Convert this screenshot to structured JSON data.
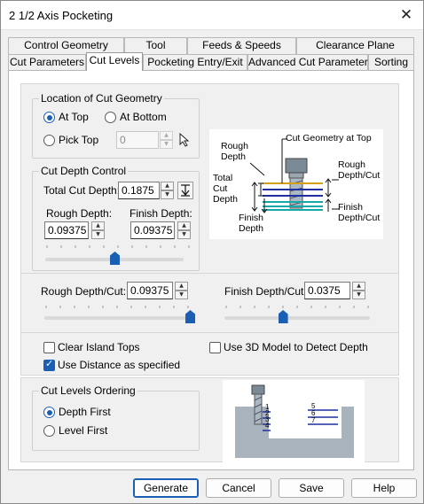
{
  "window": {
    "title": "2 1/2 Axis Pocketing",
    "close_glyph": "✕"
  },
  "tabs_back": [
    "Control Geometry",
    "Tool",
    "Feeds & Speeds",
    "Clearance Plane"
  ],
  "tabs_front": [
    "Cut Parameters",
    "Cut Levels",
    "Pocketing Entry/Exit",
    "Advanced Cut Parameters",
    "Sorting"
  ],
  "active_tab": "Cut Levels",
  "location": {
    "group_label": "Location of Cut Geometry",
    "at_top": "At Top",
    "at_bottom": "At Bottom",
    "pick_top": "Pick Top",
    "pick_top_value": "0",
    "selected": "At Top"
  },
  "depth_control": {
    "group_label": "Cut Depth Control",
    "total_label": "Total Cut Depth:",
    "total_value": "0.1875",
    "rough_label": "Rough Depth:",
    "rough_value": "0.09375",
    "finish_label": "Finish Depth:",
    "finish_value": "0.09375",
    "split_fraction": 0.5
  },
  "per_cut": {
    "rough_label": "Rough Depth/Cut:",
    "rough_value": "0.09375",
    "rough_fraction": 1.0,
    "finish_label": "Finish Depth/Cut:",
    "finish_value": "0.0375",
    "finish_fraction": 0.4
  },
  "options": {
    "clear_island": "Clear Island Tops",
    "clear_island_checked": false,
    "use_3d": "Use 3D Model to Detect Depth",
    "use_3d_checked": false,
    "use_distance": "Use Distance as specified",
    "use_distance_checked": true
  },
  "ordering": {
    "group_label": "Cut Levels Ordering",
    "depth_first": "Depth First",
    "level_first": "Level First",
    "selected": "Depth First"
  },
  "diagram1": {
    "rough_depth": "Rough Depth",
    "cut_geom": "Cut Geometry at Top",
    "total_cut_depth": "Total Cut Depth",
    "finish_depth": "Finish Depth",
    "rough_per_cut": "Rough Depth/Cut",
    "finish_per_cut": "Finish Depth/Cut"
  },
  "diagram2": {
    "labels": [
      "1",
      "2",
      "3",
      "4",
      "5",
      "6",
      "7"
    ]
  },
  "buttons": {
    "generate": "Generate",
    "cancel": "Cancel",
    "save": "Save",
    "help": "Help"
  },
  "colors": {
    "accent": "#1a5fb4",
    "cut_blue": "#1f2f9e",
    "finish_cyan": "#17a8a8",
    "stock_gray": "#a9b3bd"
  }
}
